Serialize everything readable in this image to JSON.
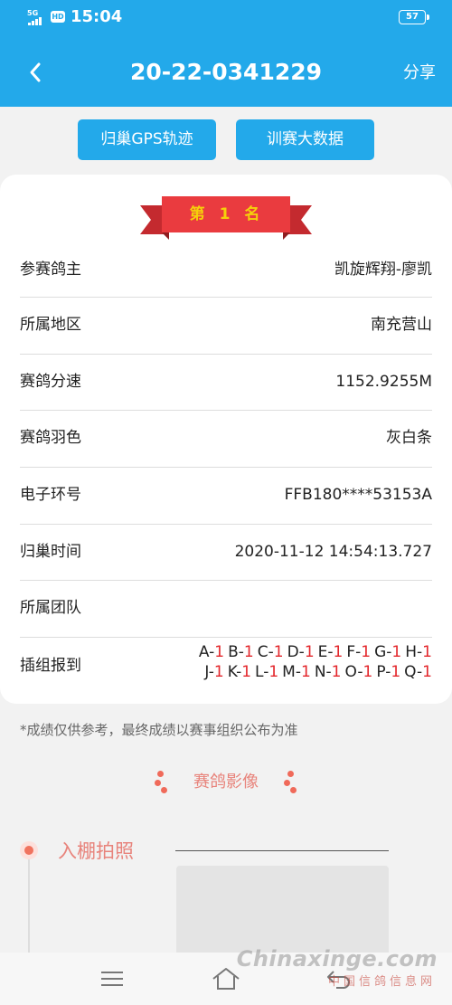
{
  "status_bar": {
    "network": "5G",
    "hd": "HD",
    "time": "15:04",
    "battery": "57"
  },
  "header": {
    "title": "20-22-0341229",
    "share_label": "分享",
    "back_icon": "chevron-left-icon",
    "background_color": "#23a9ea"
  },
  "actions": {
    "gps_label": "归巢GPS轨迹",
    "data_label": "训赛大数据"
  },
  "rank": {
    "text": "第 1 名",
    "ribbon_color": "#e8383d",
    "text_color": "#f5d10a"
  },
  "details": {
    "owner": {
      "label": "参赛鸽主",
      "value": "凯旋辉翔-廖凯"
    },
    "region": {
      "label": "所属地区",
      "value": "南充营山"
    },
    "speed": {
      "label": "赛鸽分速",
      "value": "1152.9255M"
    },
    "color": {
      "label": "赛鸽羽色",
      "value": "灰白条"
    },
    "ring": {
      "label": "电子环号",
      "value": "FFB180****53153A"
    },
    "return_time": {
      "label": "归巢时间",
      "value": "2020-11-12 14:54:13.727"
    },
    "team": {
      "label": "所属团队",
      "value": ""
    },
    "checkin": {
      "label": "插组报到",
      "line1": [
        {
          "group": "A-",
          "num": "1"
        },
        {
          "group": "B-",
          "num": "1"
        },
        {
          "group": "C-",
          "num": "1"
        },
        {
          "group": "D-",
          "num": "1"
        },
        {
          "group": "E-",
          "num": "1"
        },
        {
          "group": "F-",
          "num": "1"
        },
        {
          "group": "G-",
          "num": "1"
        },
        {
          "group": "H-",
          "num": "1"
        }
      ],
      "line2": [
        {
          "group": "J-",
          "num": "1"
        },
        {
          "group": "K-",
          "num": "1"
        },
        {
          "group": "L-",
          "num": "1"
        },
        {
          "group": "M-",
          "num": "1"
        },
        {
          "group": "N-",
          "num": "1"
        },
        {
          "group": "O-",
          "num": "1"
        },
        {
          "group": "P-",
          "num": "1"
        },
        {
          "group": "Q-",
          "num": "1"
        }
      ]
    }
  },
  "disclaimer": "*成绩仅供参考，最终成绩以赛事组织公布为准",
  "images_section": {
    "title": "赛鸽影像"
  },
  "photo": {
    "title": "入棚拍照"
  },
  "navbar": {
    "menu_icon": "menu-icon",
    "home_icon": "home-icon",
    "back_icon": "back-icon"
  },
  "watermark": {
    "main": "Chinaxinge.com",
    "sub": "中国信鸽信息网"
  }
}
